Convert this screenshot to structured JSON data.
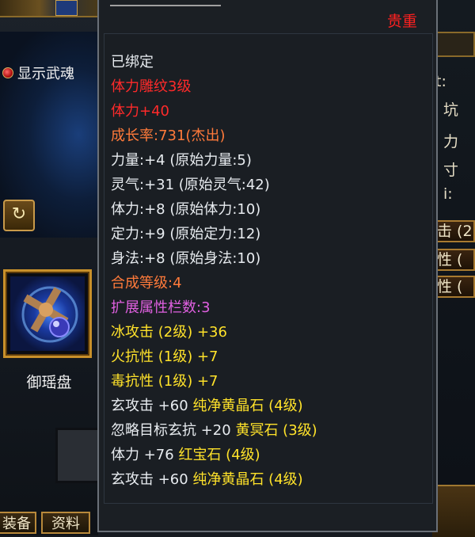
{
  "left_panel": {
    "weapon_soul_label": "显示武魂",
    "item_name": "御瑶盘",
    "tabs": [
      "装备",
      "资料"
    ]
  },
  "right_panel": {
    "rows": [
      "击 (2",
      "性 (",
      "性 ("
    ],
    "side_chars": [
      "t:",
      "坑",
      "力",
      "寸",
      "i:"
    ]
  },
  "tooltip": {
    "rarity": "贵重",
    "bound": "已绑定",
    "carving": "体力雕纹3级",
    "carving_bonus": "体力+40",
    "growth": "成长率:731(杰出)",
    "stats": [
      "力量:+4 (原始力量:5)",
      "灵气:+31 (原始灵气:42)",
      "体力:+8 (原始体力:10)",
      "定力:+9 (原始定力:12)",
      "身法:+8 (原始身法:10)"
    ],
    "synth_level": "合成等级:4",
    "ext_slots": "扩展属性栏数:3",
    "attributes": [
      "冰攻击 (2级) +36",
      "火抗性 (1级) +7",
      "毒抗性 (1级) +7"
    ],
    "gems": [
      {
        "effect": "玄攻击 +60",
        "gem": "纯净黄晶石 (4级)"
      },
      {
        "effect": "忽略目标玄抗 +20",
        "gem": "黄冥石 (3级)"
      },
      {
        "effect": "体力 +76",
        "gem": "红宝石 (4级)"
      },
      {
        "effect": "玄攻击 +60",
        "gem": "纯净黄晶石 (4级)"
      }
    ]
  },
  "colors": {
    "rarity": "#ff2020",
    "bound": "#e8ecf0",
    "carving": "#ff2a2a",
    "growth": "#ff7a3a",
    "ext_slots": "#e060e0",
    "attributes": "#ffe22a",
    "gem": "#ffe22a"
  }
}
